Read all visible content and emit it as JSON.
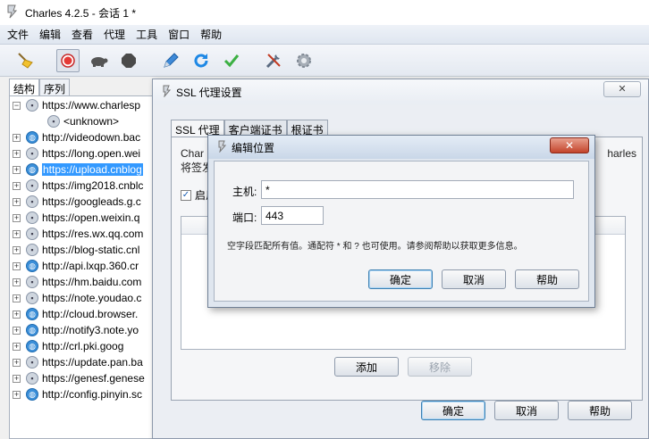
{
  "window": {
    "title": "Charles 4.2.5 - 会话 1 *"
  },
  "menu": [
    "文件",
    "编辑",
    "查看",
    "代理",
    "工具",
    "窗口",
    "帮助"
  ],
  "toolbar": {
    "buttons": [
      "broom-icon",
      "record-icon",
      "throttle-turtle-icon",
      "breakpoint-hexagon-icon",
      "compose-pen-icon",
      "repeat-refresh-icon",
      "validate-check-icon",
      "tools-icon",
      "settings-gear-icon"
    ]
  },
  "left_tabs": [
    "结构",
    "序列"
  ],
  "tree": [
    {
      "label": "https://www.charlesp",
      "expanded": true,
      "icon": "lock"
    },
    {
      "label": "<unknown>",
      "child": true,
      "icon": "lock"
    },
    {
      "label": "http://videodown.bac",
      "icon": "web"
    },
    {
      "label": "https://long.open.wei",
      "icon": "lock"
    },
    {
      "label": "https://upload.cnblog",
      "icon": "web",
      "selected": true
    },
    {
      "label": "https://img2018.cnblc",
      "icon": "lock"
    },
    {
      "label": "https://googleads.g.c",
      "icon": "lock"
    },
    {
      "label": "https://open.weixin.q",
      "icon": "lock"
    },
    {
      "label": "https://res.wx.qq.com",
      "icon": "lock"
    },
    {
      "label": "https://blog-static.cnl",
      "icon": "lock"
    },
    {
      "label": "http://api.lxqp.360.cr",
      "icon": "web"
    },
    {
      "label": "https://hm.baidu.com",
      "icon": "lock"
    },
    {
      "label": "https://note.youdao.c",
      "icon": "lock"
    },
    {
      "label": "http://cloud.browser.",
      "icon": "web"
    },
    {
      "label": "http://notify3.note.yo",
      "icon": "web"
    },
    {
      "label": "http://crl.pki.goog",
      "icon": "web"
    },
    {
      "label": "https://update.pan.ba",
      "icon": "lock"
    },
    {
      "label": "https://genesf.genese",
      "icon": "lock"
    },
    {
      "label": "http://config.pinyin.sc",
      "icon": "web"
    }
  ],
  "ssl_dialog": {
    "title": "SSL 代理设置",
    "close": "✕",
    "tabs": [
      "SSL 代理",
      "客户端证书",
      "根证书"
    ],
    "desc_line1": "Char",
    "desc_right": "harles",
    "desc_line2": "将签发",
    "enable_label": "启用",
    "add": "添加",
    "remove": "移除",
    "ok": "确定",
    "cancel": "取消",
    "help": "帮助"
  },
  "edit_dialog": {
    "title": "编辑位置",
    "close": "✕",
    "host_label": "主机:",
    "host_value": "*",
    "port_label": "端口:",
    "port_value": "443",
    "hint": "空字段匹配所有值。通配符 * 和 ? 也可使用。请参阅帮助以获取更多信息。",
    "ok": "确定",
    "cancel": "取消",
    "help": "帮助"
  }
}
